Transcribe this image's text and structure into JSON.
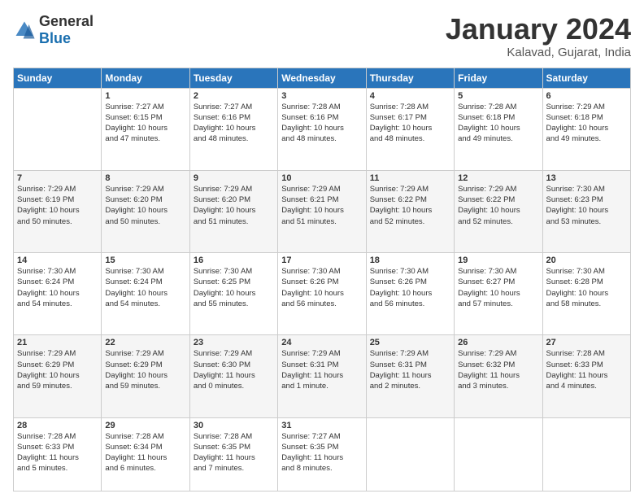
{
  "header": {
    "logo_general": "General",
    "logo_blue": "Blue",
    "title": "January 2024",
    "subtitle": "Kalavad, Gujarat, India"
  },
  "weekdays": [
    "Sunday",
    "Monday",
    "Tuesday",
    "Wednesday",
    "Thursday",
    "Friday",
    "Saturday"
  ],
  "weeks": [
    [
      {
        "day": "",
        "lines": []
      },
      {
        "day": "1",
        "lines": [
          "Sunrise: 7:27 AM",
          "Sunset: 6:15 PM",
          "Daylight: 10 hours",
          "and 47 minutes."
        ]
      },
      {
        "day": "2",
        "lines": [
          "Sunrise: 7:27 AM",
          "Sunset: 6:16 PM",
          "Daylight: 10 hours",
          "and 48 minutes."
        ]
      },
      {
        "day": "3",
        "lines": [
          "Sunrise: 7:28 AM",
          "Sunset: 6:16 PM",
          "Daylight: 10 hours",
          "and 48 minutes."
        ]
      },
      {
        "day": "4",
        "lines": [
          "Sunrise: 7:28 AM",
          "Sunset: 6:17 PM",
          "Daylight: 10 hours",
          "and 48 minutes."
        ]
      },
      {
        "day": "5",
        "lines": [
          "Sunrise: 7:28 AM",
          "Sunset: 6:18 PM",
          "Daylight: 10 hours",
          "and 49 minutes."
        ]
      },
      {
        "day": "6",
        "lines": [
          "Sunrise: 7:29 AM",
          "Sunset: 6:18 PM",
          "Daylight: 10 hours",
          "and 49 minutes."
        ]
      }
    ],
    [
      {
        "day": "7",
        "lines": [
          "Sunrise: 7:29 AM",
          "Sunset: 6:19 PM",
          "Daylight: 10 hours",
          "and 50 minutes."
        ]
      },
      {
        "day": "8",
        "lines": [
          "Sunrise: 7:29 AM",
          "Sunset: 6:20 PM",
          "Daylight: 10 hours",
          "and 50 minutes."
        ]
      },
      {
        "day": "9",
        "lines": [
          "Sunrise: 7:29 AM",
          "Sunset: 6:20 PM",
          "Daylight: 10 hours",
          "and 51 minutes."
        ]
      },
      {
        "day": "10",
        "lines": [
          "Sunrise: 7:29 AM",
          "Sunset: 6:21 PM",
          "Daylight: 10 hours",
          "and 51 minutes."
        ]
      },
      {
        "day": "11",
        "lines": [
          "Sunrise: 7:29 AM",
          "Sunset: 6:22 PM",
          "Daylight: 10 hours",
          "and 52 minutes."
        ]
      },
      {
        "day": "12",
        "lines": [
          "Sunrise: 7:29 AM",
          "Sunset: 6:22 PM",
          "Daylight: 10 hours",
          "and 52 minutes."
        ]
      },
      {
        "day": "13",
        "lines": [
          "Sunrise: 7:30 AM",
          "Sunset: 6:23 PM",
          "Daylight: 10 hours",
          "and 53 minutes."
        ]
      }
    ],
    [
      {
        "day": "14",
        "lines": [
          "Sunrise: 7:30 AM",
          "Sunset: 6:24 PM",
          "Daylight: 10 hours",
          "and 54 minutes."
        ]
      },
      {
        "day": "15",
        "lines": [
          "Sunrise: 7:30 AM",
          "Sunset: 6:24 PM",
          "Daylight: 10 hours",
          "and 54 minutes."
        ]
      },
      {
        "day": "16",
        "lines": [
          "Sunrise: 7:30 AM",
          "Sunset: 6:25 PM",
          "Daylight: 10 hours",
          "and 55 minutes."
        ]
      },
      {
        "day": "17",
        "lines": [
          "Sunrise: 7:30 AM",
          "Sunset: 6:26 PM",
          "Daylight: 10 hours",
          "and 56 minutes."
        ]
      },
      {
        "day": "18",
        "lines": [
          "Sunrise: 7:30 AM",
          "Sunset: 6:26 PM",
          "Daylight: 10 hours",
          "and 56 minutes."
        ]
      },
      {
        "day": "19",
        "lines": [
          "Sunrise: 7:30 AM",
          "Sunset: 6:27 PM",
          "Daylight: 10 hours",
          "and 57 minutes."
        ]
      },
      {
        "day": "20",
        "lines": [
          "Sunrise: 7:30 AM",
          "Sunset: 6:28 PM",
          "Daylight: 10 hours",
          "and 58 minutes."
        ]
      }
    ],
    [
      {
        "day": "21",
        "lines": [
          "Sunrise: 7:29 AM",
          "Sunset: 6:29 PM",
          "Daylight: 10 hours",
          "and 59 minutes."
        ]
      },
      {
        "day": "22",
        "lines": [
          "Sunrise: 7:29 AM",
          "Sunset: 6:29 PM",
          "Daylight: 10 hours",
          "and 59 minutes."
        ]
      },
      {
        "day": "23",
        "lines": [
          "Sunrise: 7:29 AM",
          "Sunset: 6:30 PM",
          "Daylight: 11 hours",
          "and 0 minutes."
        ]
      },
      {
        "day": "24",
        "lines": [
          "Sunrise: 7:29 AM",
          "Sunset: 6:31 PM",
          "Daylight: 11 hours",
          "and 1 minute."
        ]
      },
      {
        "day": "25",
        "lines": [
          "Sunrise: 7:29 AM",
          "Sunset: 6:31 PM",
          "Daylight: 11 hours",
          "and 2 minutes."
        ]
      },
      {
        "day": "26",
        "lines": [
          "Sunrise: 7:29 AM",
          "Sunset: 6:32 PM",
          "Daylight: 11 hours",
          "and 3 minutes."
        ]
      },
      {
        "day": "27",
        "lines": [
          "Sunrise: 7:28 AM",
          "Sunset: 6:33 PM",
          "Daylight: 11 hours",
          "and 4 minutes."
        ]
      }
    ],
    [
      {
        "day": "28",
        "lines": [
          "Sunrise: 7:28 AM",
          "Sunset: 6:33 PM",
          "Daylight: 11 hours",
          "and 5 minutes."
        ]
      },
      {
        "day": "29",
        "lines": [
          "Sunrise: 7:28 AM",
          "Sunset: 6:34 PM",
          "Daylight: 11 hours",
          "and 6 minutes."
        ]
      },
      {
        "day": "30",
        "lines": [
          "Sunrise: 7:28 AM",
          "Sunset: 6:35 PM",
          "Daylight: 11 hours",
          "and 7 minutes."
        ]
      },
      {
        "day": "31",
        "lines": [
          "Sunrise: 7:27 AM",
          "Sunset: 6:35 PM",
          "Daylight: 11 hours",
          "and 8 minutes."
        ]
      },
      {
        "day": "",
        "lines": []
      },
      {
        "day": "",
        "lines": []
      },
      {
        "day": "",
        "lines": []
      }
    ]
  ]
}
